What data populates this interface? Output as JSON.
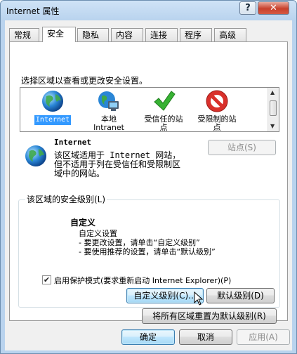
{
  "window": {
    "title": "Internet 属性",
    "help_label": "?",
    "close_label": "✕"
  },
  "tabs": [
    {
      "label": "常规"
    },
    {
      "label": "安全"
    },
    {
      "label": "隐私"
    },
    {
      "label": "内容"
    },
    {
      "label": "连接"
    },
    {
      "label": "程序"
    },
    {
      "label": "高级"
    }
  ],
  "security": {
    "select_prompt": "选择区域以查看或更改安全设置。",
    "zones": [
      {
        "line1": "Internet",
        "line2": "",
        "icon": "globe-icon"
      },
      {
        "line1": "本地",
        "line2": "Intranet",
        "icon": "intranet-globe-icon"
      },
      {
        "line1": "受信任的站",
        "line2": "点",
        "icon": "green-check-icon"
      },
      {
        "line1": "受限制的站",
        "line2": "点",
        "icon": "no-entry-icon"
      }
    ],
    "zone_name": "Internet",
    "zone_description": "该区域适用于 Internet 网站，但不适用于列在受信任和受限制区域中的网站。",
    "sites_button": "站点(S)",
    "level_group_title": "该区域的安全级别(L)",
    "level_name": "自定义",
    "level_lines": [
      "自定义设置",
      "- 要更改设置，请单击“自定义级别”",
      "- 要使用推荐的设置，请单击“默认级别”"
    ],
    "protected_mode_label": "启用保护模式(要求重新启动 Internet Explorer)(P)",
    "protected_mode_checked": true,
    "custom_level_button": "自定义级别(C)...",
    "default_level_button": "默认级别(D)",
    "reset_all_button": "将所有区域重置为默认级别(R)"
  },
  "footer": {
    "ok": "确定",
    "cancel": "取消",
    "apply": "应用(A)"
  },
  "colors": {
    "selection": "#3399ff",
    "title_bg": "#b9d3ee",
    "close_red": "#c8402b"
  }
}
